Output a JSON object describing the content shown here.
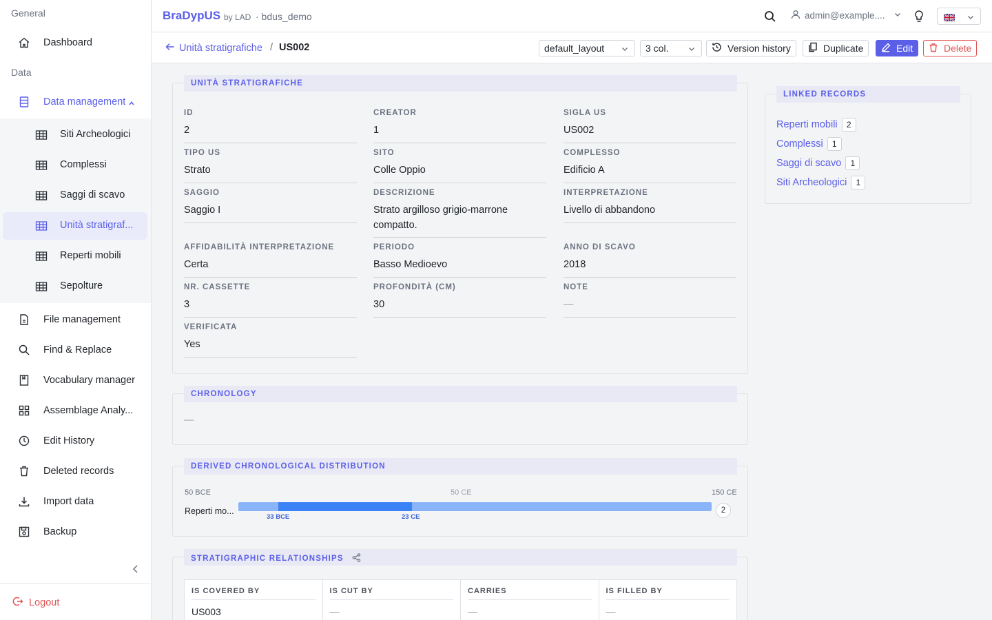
{
  "sidebar": {
    "sections": {
      "general": "General",
      "data": "Data"
    },
    "items": {
      "dashboard": "Dashboard",
      "data_management": "Data management",
      "file_management": "File management",
      "find_replace": "Find & Replace",
      "vocabulary_manager": "Vocabulary manager",
      "assemblage_analysis": "Assemblage Analy...",
      "edit_history": "Edit History",
      "deleted_records": "Deleted records",
      "import_data": "Import data",
      "backup": "Backup"
    },
    "subitems": [
      "Siti Archeologici",
      "Complessi",
      "Saggi di scavo",
      "Unità stratigraf...",
      "Reperti mobili",
      "Sepolture"
    ],
    "logout": "Logout"
  },
  "topbar": {
    "brand": "BraDypUS",
    "brand_by": "by LAD",
    "database": "· bdus_demo",
    "user": "admin@example...."
  },
  "header": {
    "back_label": "Unità stratigrafiche",
    "separator": "/",
    "current": "US002",
    "layout_select": "default_layout",
    "columns_select": "3 col.",
    "version_history": "Version history",
    "duplicate": "Duplicate",
    "edit": "Edit",
    "delete": "Delete"
  },
  "main_card": {
    "title": "UNITÀ STRATIGRAFICHE",
    "fields": [
      {
        "label": "ID",
        "value": "2"
      },
      {
        "label": "CREATOR",
        "value": "1"
      },
      {
        "label": "SIGLA US",
        "value": "US002"
      },
      {
        "label": "TIPO US",
        "value": "Strato"
      },
      {
        "label": "SITO",
        "value": "Colle Oppio"
      },
      {
        "label": "COMPLESSO",
        "value": "Edificio A"
      },
      {
        "label": "SAGGIO",
        "value": "Saggio I"
      },
      {
        "label": "DESCRIZIONE",
        "value": "Strato argilloso grigio-marrone compatto."
      },
      {
        "label": "INTERPRETAZIONE",
        "value": "Livello di abbandono"
      },
      {
        "label": "AFFIDABILITÀ INTERPRETAZIONE",
        "value": "Certa"
      },
      {
        "label": "PERIODO",
        "value": "Basso Medioevo"
      },
      {
        "label": "ANNO DI SCAVO",
        "value": "2018"
      },
      {
        "label": "NR. CASSETTE",
        "value": "3"
      },
      {
        "label": "PROFONDITÀ (CM)",
        "value": "30"
      },
      {
        "label": "NOTE",
        "value": "—"
      },
      {
        "label": "VERIFICATA",
        "value": "Yes"
      }
    ]
  },
  "linked": {
    "title": "LINKED RECORDS",
    "items": [
      {
        "label": "Reperti mobili",
        "count": "2"
      },
      {
        "label": "Complessi",
        "count": "1"
      },
      {
        "label": "Saggi di scavo",
        "count": "1"
      },
      {
        "label": "Siti Archeologici",
        "count": "1"
      }
    ]
  },
  "chronology": {
    "title": "CHRONOLOGY",
    "value": "—"
  },
  "distribution": {
    "title": "DERIVED CHRONOLOGICAL DISTRIBUTION",
    "axis": {
      "start": "50 BCE",
      "mid": "50 CE",
      "end": "150 CE"
    },
    "row_label": "Reperti mo...",
    "range_start": "33 BCE",
    "range_end": "23 CE",
    "count": "2"
  },
  "relationships": {
    "title": "STRATIGRAPHIC RELATIONSHIPS",
    "columns": [
      {
        "label": "IS COVERED BY",
        "value": "US003"
      },
      {
        "label": "IS CUT BY",
        "value": "—"
      },
      {
        "label": "CARRIES",
        "value": "—"
      },
      {
        "label": "IS FILLED BY",
        "value": "—"
      }
    ]
  },
  "colors": {
    "accent": "#5b5fe8",
    "danger": "#e25555",
    "bar_light": "#8ab4f8",
    "bar_dark": "#3b82f6"
  }
}
